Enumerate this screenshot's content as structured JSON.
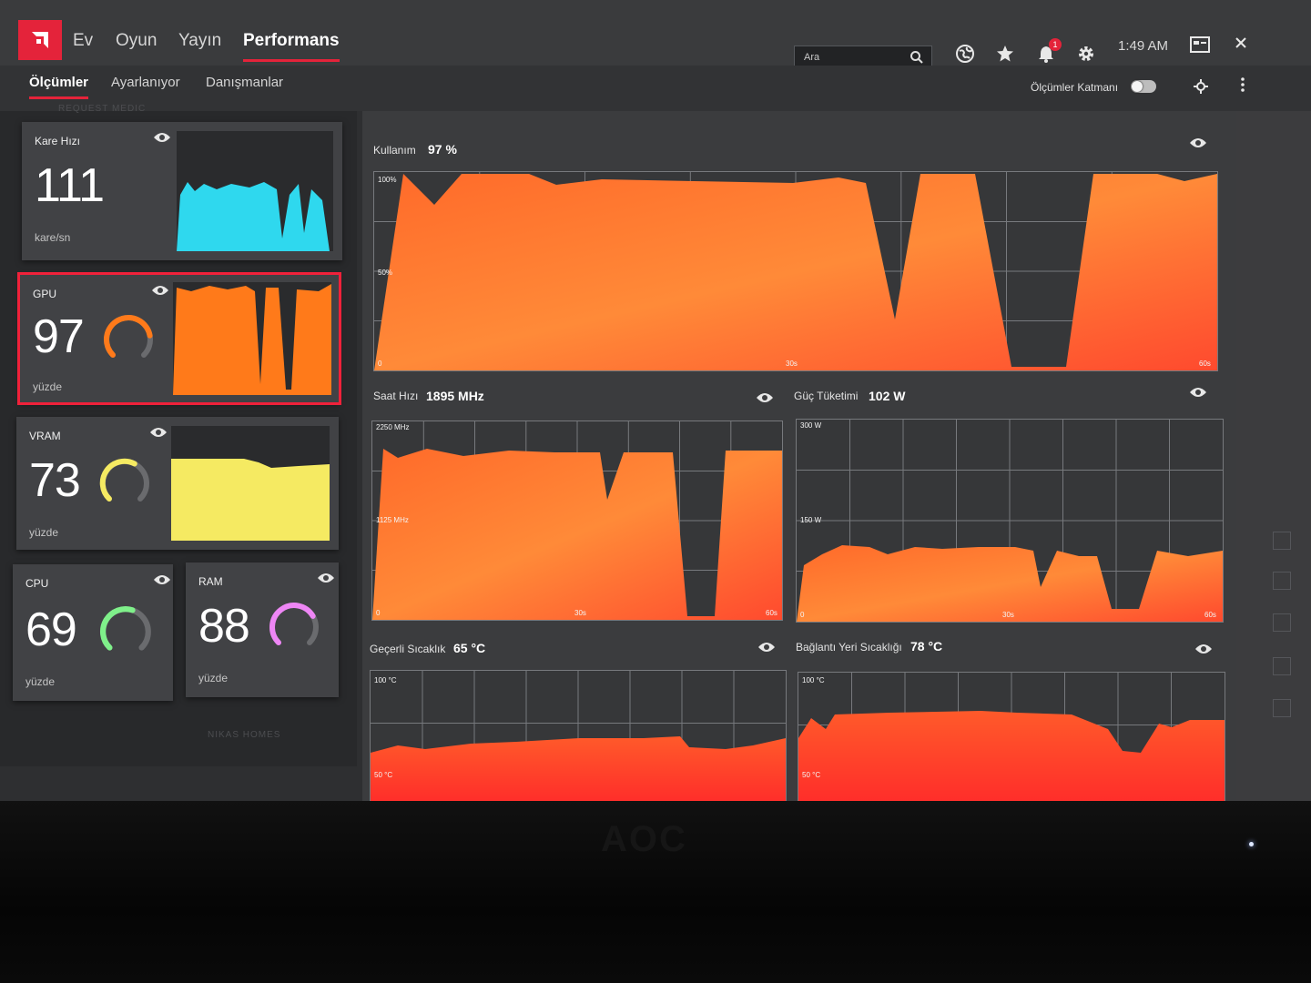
{
  "topbar": {
    "nav": [
      "Ev",
      "Oyun",
      "Yayın",
      "Performans"
    ],
    "search_placeholder": "Ara",
    "notification_count": "1",
    "time": "1:49 AM"
  },
  "subnav": {
    "tabs": [
      "Ölçümler",
      "Ayarlanıyor",
      "Danışmanlar"
    ],
    "overlay_label": "Ölçümler Katmanı"
  },
  "left": {
    "fps": {
      "label": "Kare Hızı",
      "value": "111",
      "unit": "kare/sn",
      "color": "#2fd8ee"
    },
    "gpu": {
      "label": "GPU",
      "value": "97",
      "unit": "yüzde",
      "color": "#ff7a1a",
      "level": 0.97
    },
    "vram": {
      "label": "VRAM",
      "value": "73",
      "unit": "yüzde",
      "color": "#f5ea62",
      "level": 0.73
    },
    "cpu": {
      "label": "CPU",
      "value": "69",
      "unit": "yüzde",
      "color": "#7ff08a",
      "level": 0.69
    },
    "ram": {
      "label": "RAM",
      "value": "88",
      "unit": "yüzde",
      "color": "#ee86f5",
      "level": 0.88
    },
    "faint_top": "REQUEST MEDIC",
    "faint_bottom": "NIKAS HOMES"
  },
  "charts": {
    "usage": {
      "title": "Kullanım",
      "value": "97 %",
      "y_top": "100%",
      "y_mid": "50%",
      "y_bot": "0",
      "x_mid": "30s",
      "x_end": "60s"
    },
    "clock": {
      "title": "Saat Hızı",
      "value": "1895 MHz",
      "y_top": "2250 MHz",
      "y_mid": "1125 MHz",
      "y_bot": "0",
      "x_mid": "30s",
      "x_end": "60s"
    },
    "power": {
      "title": "Güç Tüketimi",
      "value": "102 W",
      "y_top": "300 W",
      "y_mid": "150 W",
      "y_bot": "0",
      "x_mid": "30s",
      "x_end": "60s"
    },
    "temp": {
      "title": "Geçerli Sıcaklık",
      "value": "65 °C",
      "y_top": "100 °C",
      "y_mid": "50 °C"
    },
    "junction": {
      "title": "Bağlantı Yeri Sıcaklığı",
      "value": "78 °C",
      "y_top": "100 °C",
      "y_mid": "50 °C"
    }
  },
  "bezel": {
    "brand": "AOC"
  },
  "colors": {
    "accent": "#e4233a",
    "chart_fill": "#ff7a2e"
  }
}
